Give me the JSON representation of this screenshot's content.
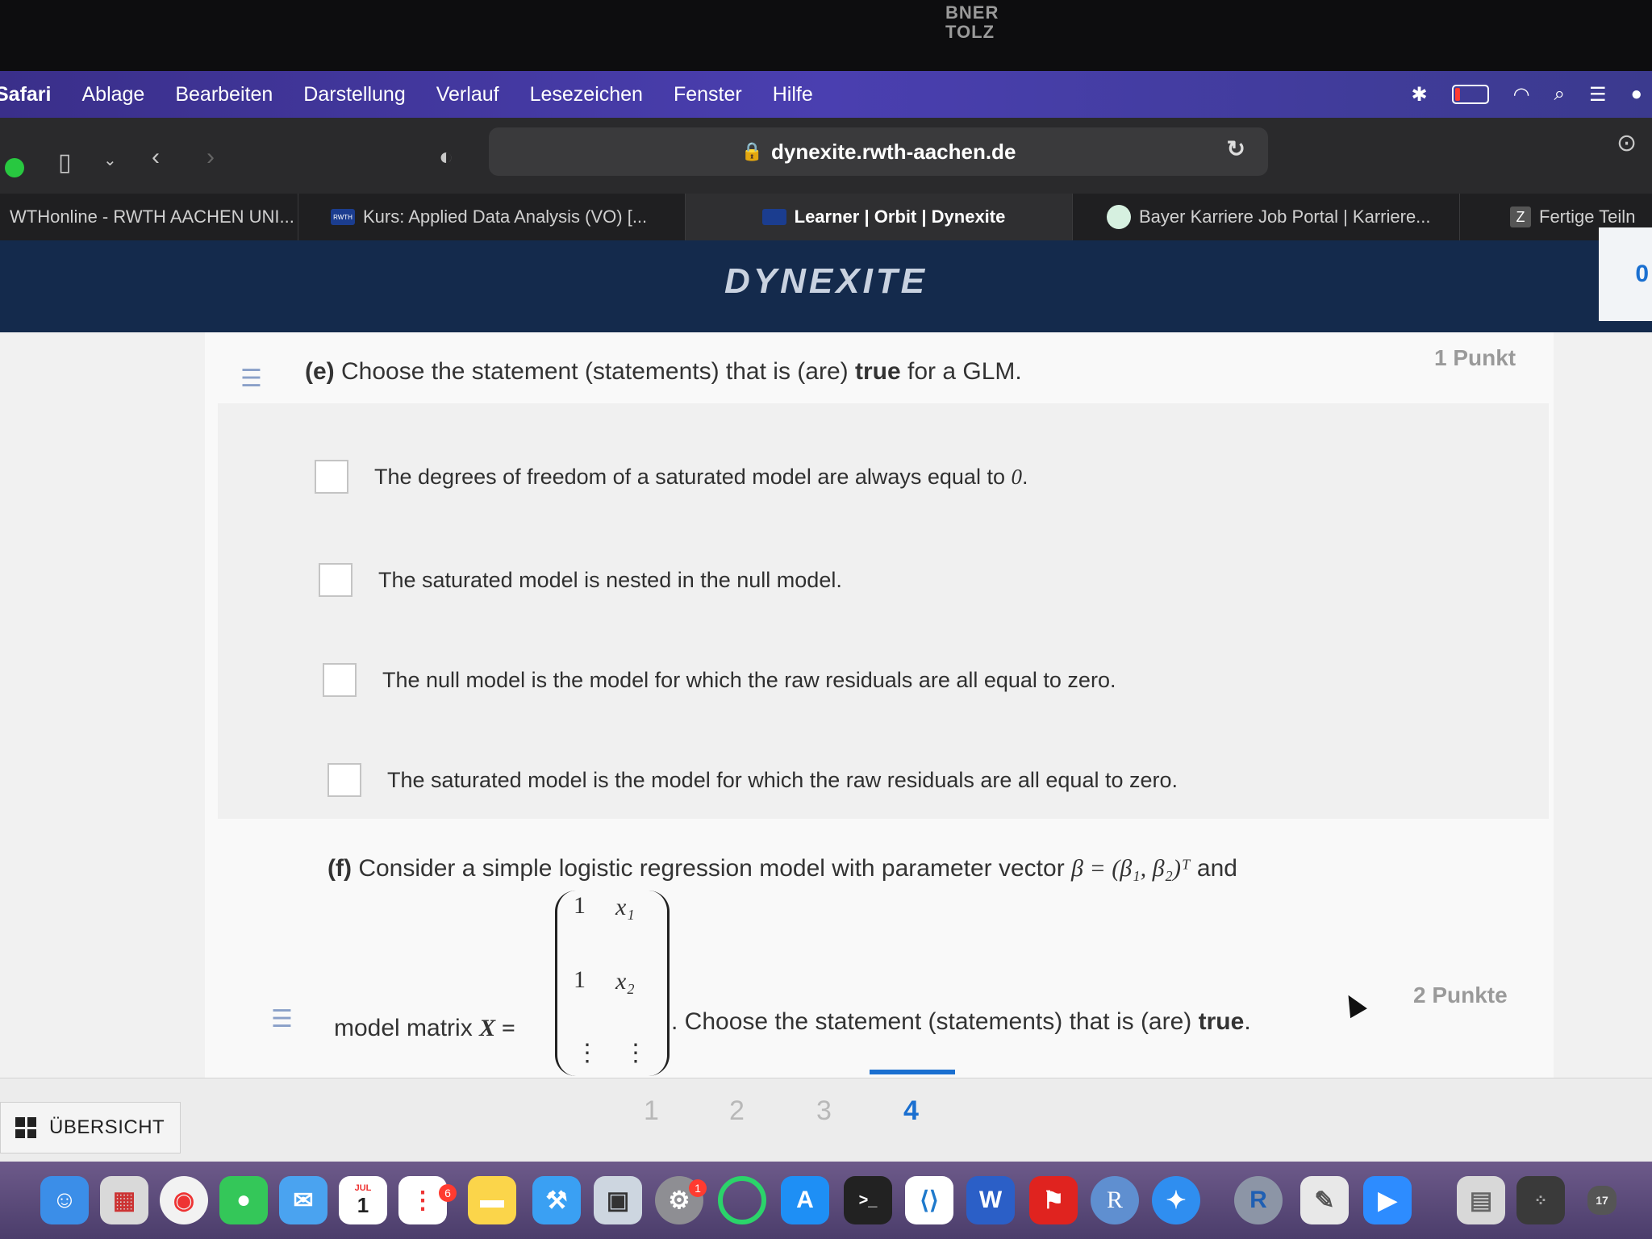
{
  "notch_label": "BNER\nTOLZ",
  "menubar": {
    "app": "Safari",
    "items": [
      "Ablage",
      "Bearbeiten",
      "Darstellung",
      "Verlauf",
      "Lesezeichen",
      "Fenster",
      "Hilfe"
    ]
  },
  "url": "dynexite.rwth-aachen.de",
  "tabs": [
    {
      "label": "WTHonline - RWTH AACHEN UNI..."
    },
    {
      "label": "Kurs: Applied Data Analysis (VO) [..."
    },
    {
      "label": "Learner | Orbit | Dynexite"
    },
    {
      "label": "Bayer Karriere Job Portal | Karriere..."
    },
    {
      "label": "Fertige Teiln"
    }
  ],
  "brand": "DYNEXITE",
  "header_badge": "0",
  "question_e": {
    "label": "(e)",
    "text_before": "Choose the statement (statements) that is (are)",
    "bold": "true",
    "text_after": "for a GLM.",
    "points": "1 Punkt",
    "options": [
      {
        "text": "The degrees of freedom of a saturated model are always equal to",
        "math": "0",
        "end": "."
      },
      {
        "text": "The saturated model is nested in the null model.",
        "math": "",
        "end": ""
      },
      {
        "text": "The null model is the model for which the raw residuals are all equal to zero.",
        "math": "",
        "end": ""
      },
      {
        "text": "The saturated model is the model for which the raw residuals are all equal to zero.",
        "math": "",
        "end": ""
      }
    ]
  },
  "question_f": {
    "label": "(f)",
    "text": "Consider a simple logistic regression model with parameter vector",
    "param_math": "β = (β₁, β₂)ᵀ",
    "and": "and",
    "matrix_label": "model matrix",
    "matrix_math": "X =",
    "matrix": {
      "r1c1": "1",
      "r1c2": "x₁",
      "r2c1": "1",
      "r2c2": "x₂",
      "r3c1": "⋮",
      "r3c2": "⋮"
    },
    "text2_before": ". Choose the statement (statements) that is (are)",
    "text2_bold": "true",
    "text2_after": ".",
    "points": "2 Punkte"
  },
  "footer": {
    "overview": "ÜBERSICHT",
    "pages": [
      "1",
      "2",
      "3",
      "4"
    ],
    "active_page": "4"
  },
  "dock": {
    "calendar_month": "JUL",
    "calendar_day": "1",
    "reminders_badge": "6",
    "settings_badge": "1",
    "date_small": "17"
  }
}
